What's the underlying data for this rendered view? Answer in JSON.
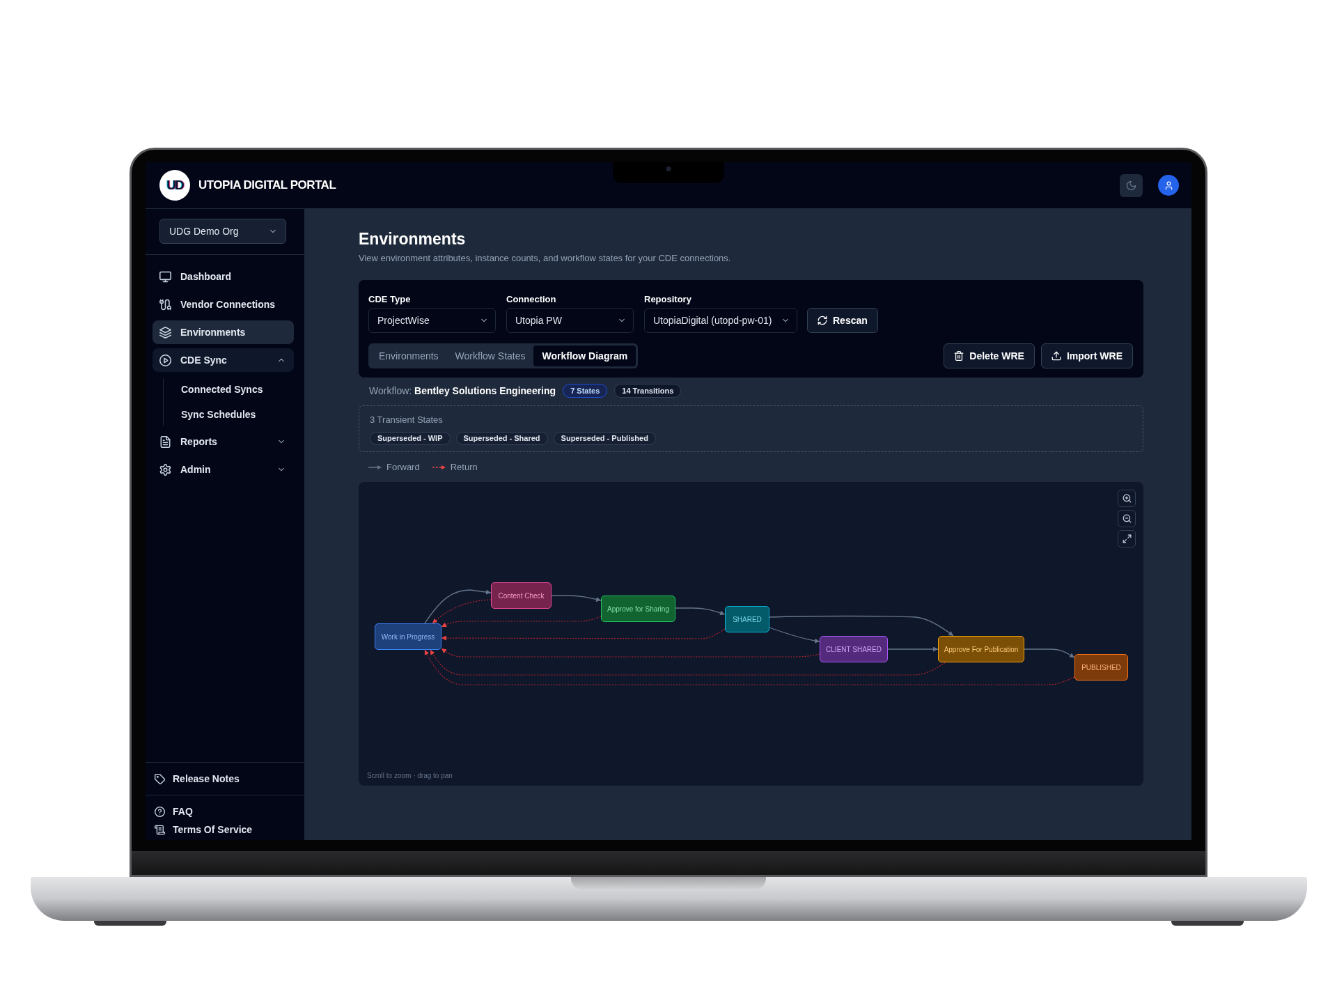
{
  "top_bar": {
    "logo_text": "UD",
    "title": "UTOPIA DIGITAL PORTAL"
  },
  "sidebar": {
    "org_select": {
      "value": "UDG Demo Org"
    },
    "items": [
      {
        "label": "Dashboard",
        "selected": false
      },
      {
        "label": "Vendor Connections",
        "selected": false
      },
      {
        "label": "Environments",
        "selected": true
      },
      {
        "label": "CDE Sync",
        "selected": false,
        "expanded": true,
        "children": [
          {
            "label": "Connected Syncs",
            "selected": false
          },
          {
            "label": "Sync Schedules",
            "selected": false
          }
        ]
      },
      {
        "label": "Reports",
        "selected": false,
        "expanded": false
      },
      {
        "label": "Admin",
        "selected": false,
        "expanded": false
      }
    ],
    "footer": [
      {
        "items": [
          {
            "label": "Release Notes"
          }
        ]
      },
      {
        "items": [
          {
            "label": "FAQ"
          },
          {
            "label": "Terms Of Service"
          }
        ]
      }
    ]
  },
  "page": {
    "title": "Environments",
    "subtitle": "View environment attributes, instance counts, and workflow states for your CDE connections."
  },
  "filters": [
    {
      "label": "CDE Type",
      "value": "ProjectWise"
    },
    {
      "label": "Connection",
      "value": "Utopia PW"
    },
    {
      "label": "Repository",
      "value": "UtopiaDigital (utopd-pw-01)"
    }
  ],
  "rescan_button": {
    "label": "Rescan"
  },
  "tabs": [
    {
      "label": "Environments",
      "selected": false
    },
    {
      "label": "Workflow States",
      "selected": false
    },
    {
      "label": "Workflow Diagram",
      "selected": true
    }
  ],
  "actions": [
    {
      "label": "Delete WRE"
    },
    {
      "label": "Import WRE"
    }
  ],
  "workflow": {
    "text": "Workflow: **Bentley Solutions Engineering**",
    "badges": [
      {
        "label": "7 States",
        "kind": "primary"
      },
      {
        "label": "14 Transitions",
        "kind": "neutral"
      }
    ]
  },
  "transient_states": {
    "title": "3 Transient States",
    "chips": [
      "Superseded - WIP",
      "Superseded - Shared",
      "Superseded - Published"
    ]
  },
  "legend": [
    {
      "label": "Forward",
      "kind": "forward"
    },
    {
      "label": "Return",
      "kind": "return"
    }
  ],
  "diagram": {
    "nodes": [
      {
        "label": "Work in Progress",
        "color": "#3b82f6"
      },
      {
        "label": "Content Check",
        "color": "#ec4899"
      },
      {
        "label": "Approve for Sharing",
        "color": "#22c55e"
      },
      {
        "label": "SHARED",
        "color": "#06b6d4"
      },
      {
        "label": "CLIENT SHARED",
        "color": "#a855f7"
      },
      {
        "label": "Approve For Publication",
        "color": "#f59e0b"
      },
      {
        "label": "PUBLISHED",
        "color": "#f97316"
      }
    ],
    "hint": "Scroll to zoom · drag to pan"
  }
}
